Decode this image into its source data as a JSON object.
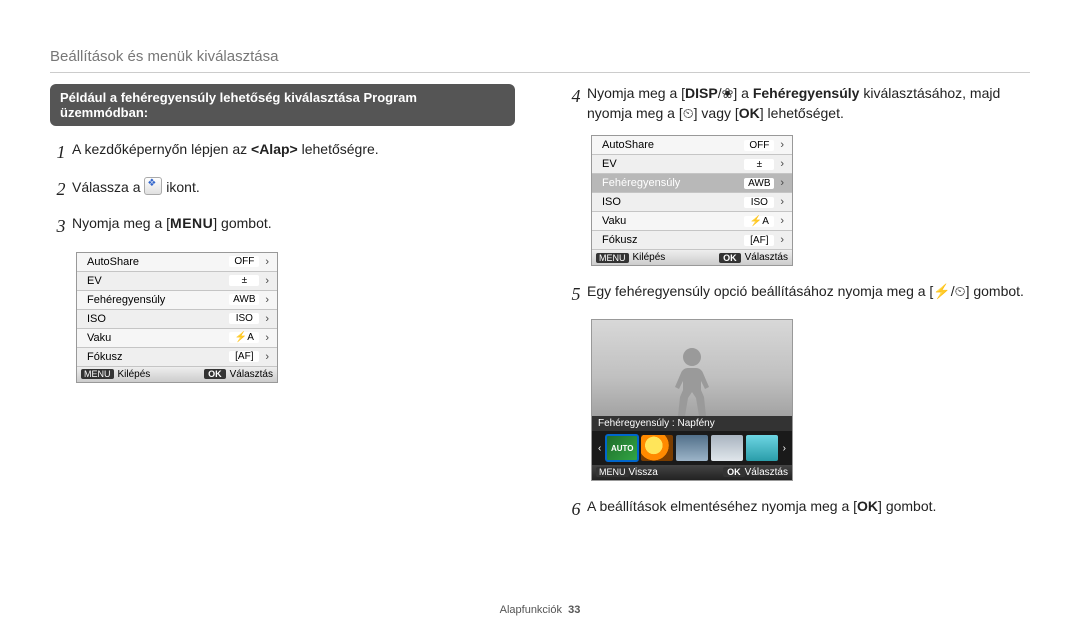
{
  "header": "Beállítások és menük kiválasztása",
  "mode_banner": "Például a fehéregyensúly lehetőség kiválasztása Program üzemmódban:",
  "steps": {
    "s1_pre": "A kezdőképernyőn lépjen az ",
    "s1_bold": "<Alap>",
    "s1_post": " lehetőségre.",
    "s2_pre": "Válassza a ",
    "s2_post": " ikont.",
    "s3_pre": "Nyomja meg a [",
    "s3_menu": "MENU",
    "s3_post": "] gombot.",
    "s4_pre": "Nyomja meg a [",
    "s4_disp": "DISP",
    "s4_mid1": "] a ",
    "s4_bold": "Fehéregyensúly",
    "s4_mid2": " kiválasztásához, majd nyomja meg a [",
    "s4_or": "] vagy [",
    "s4_ok": "OK",
    "s4_end": "] lehetőséget.",
    "s5_pre": "Egy fehéregyensúly opció beállításához nyomja meg a [",
    "s5_end": "] gombot.",
    "s6_pre": "A beállítások elmentéséhez nyomja meg a [",
    "s6_ok": "OK",
    "s6_end": "] gombot."
  },
  "menu_items": [
    {
      "label": "AutoShare",
      "val": "OFF"
    },
    {
      "label": "EV",
      "val": "±"
    },
    {
      "label": "Fehéregyensúly",
      "val": "AWB"
    },
    {
      "label": "ISO",
      "val": "ISO"
    },
    {
      "label": "Vaku",
      "val": "⚡A"
    },
    {
      "label": "Fókusz",
      "val": "[AF]"
    }
  ],
  "menu_items_sel": [
    {
      "label": "AutoShare",
      "val": "OFF",
      "sel": false
    },
    {
      "label": "EV",
      "val": "±",
      "sel": false
    },
    {
      "label": "Fehéregyensúly",
      "val": "AWB",
      "sel": true
    },
    {
      "label": "ISO",
      "val": "ISO",
      "sel": false
    },
    {
      "label": "Vaku",
      "val": "⚡A",
      "sel": false
    },
    {
      "label": "Fókusz",
      "val": "[AF]",
      "sel": false
    }
  ],
  "statusbar": {
    "menu_key": "MENU",
    "back_label": "Kilépés",
    "ok_key": "OK",
    "select_label": "Választás"
  },
  "wb": {
    "label": "Fehéregyensúly : Napfény",
    "auto": "AUTO",
    "statusbar": {
      "menu_key": "MENU",
      "back_label": "Vissza",
      "ok_key": "OK",
      "select_label": "Választás"
    }
  },
  "footer": {
    "label": "Alapfunkciók",
    "page": "33"
  }
}
